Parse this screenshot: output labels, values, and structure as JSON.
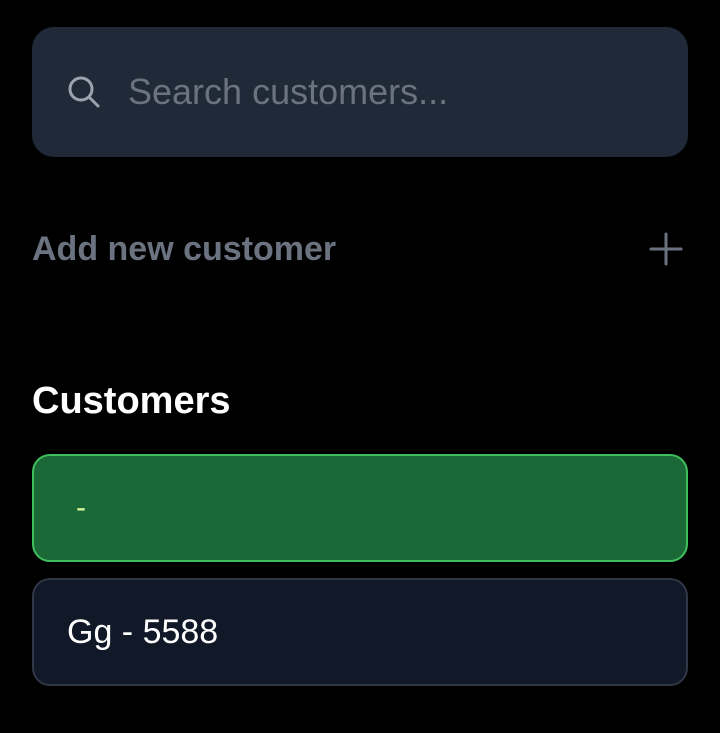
{
  "search": {
    "placeholder": "Search customers...",
    "value": ""
  },
  "add_customer": {
    "label": "Add new customer",
    "icon": "plus-icon"
  },
  "customers_section": {
    "title": "Customers",
    "items": [
      {
        "label": "-",
        "selected": true
      },
      {
        "label": "Gg - 5588",
        "selected": false
      }
    ]
  },
  "colors": {
    "background": "#000000",
    "search_bg": "#1f2937",
    "muted_text": "#6b7280",
    "selected_bg": "#1a6936",
    "selected_border": "#3fbf5e",
    "card_bg": "#111827",
    "card_border": "#2f3645"
  }
}
